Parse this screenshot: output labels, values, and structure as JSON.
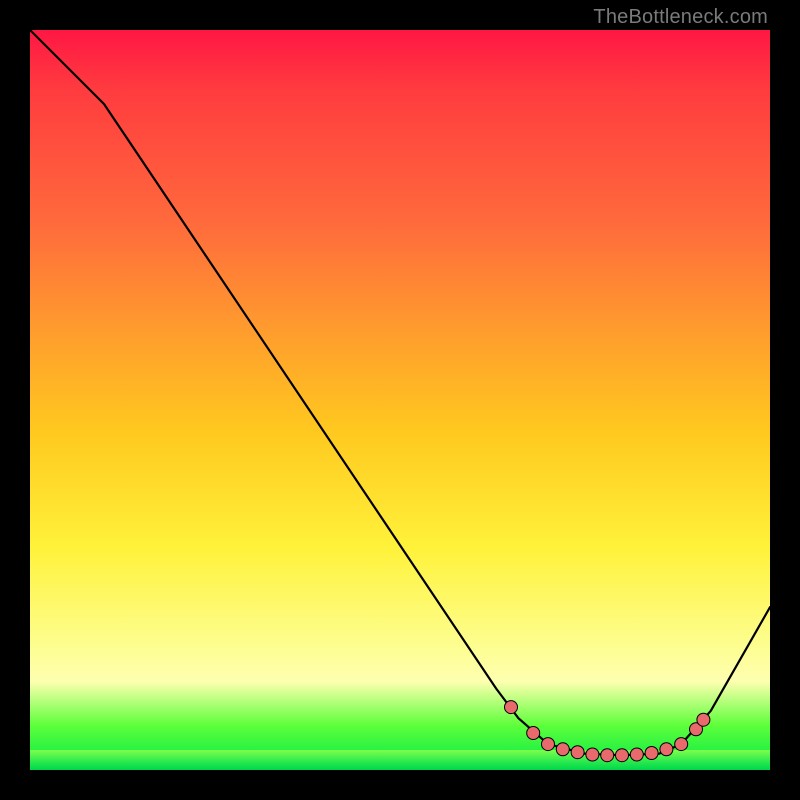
{
  "watermark": "TheBottleneck.com",
  "colors": {
    "curve_stroke": "#000000",
    "marker_fill": "#e96a6d",
    "marker_stroke": "#000000"
  },
  "chart_data": {
    "type": "line",
    "title": "",
    "xlabel": "",
    "ylabel": "",
    "xlim": [
      0,
      100
    ],
    "ylim": [
      0,
      100
    ],
    "grid": false,
    "curve": [
      {
        "x": 0,
        "y": 100
      },
      {
        "x": 6,
        "y": 94
      },
      {
        "x": 10,
        "y": 90
      },
      {
        "x": 63,
        "y": 11
      },
      {
        "x": 66,
        "y": 7
      },
      {
        "x": 70,
        "y": 3.5
      },
      {
        "x": 75,
        "y": 2.2
      },
      {
        "x": 80,
        "y": 2.0
      },
      {
        "x": 85,
        "y": 2.2
      },
      {
        "x": 88,
        "y": 3.5
      },
      {
        "x": 92,
        "y": 8
      },
      {
        "x": 100,
        "y": 22
      }
    ],
    "markers": [
      {
        "x": 65,
        "y": 8.5
      },
      {
        "x": 68,
        "y": 5.0
      },
      {
        "x": 70,
        "y": 3.5
      },
      {
        "x": 72,
        "y": 2.8
      },
      {
        "x": 74,
        "y": 2.4
      },
      {
        "x": 76,
        "y": 2.1
      },
      {
        "x": 78,
        "y": 2.0
      },
      {
        "x": 80,
        "y": 2.0
      },
      {
        "x": 82,
        "y": 2.1
      },
      {
        "x": 84,
        "y": 2.3
      },
      {
        "x": 86,
        "y": 2.8
      },
      {
        "x": 88,
        "y": 3.5
      },
      {
        "x": 90,
        "y": 5.5
      },
      {
        "x": 91,
        "y": 6.8
      }
    ]
  }
}
